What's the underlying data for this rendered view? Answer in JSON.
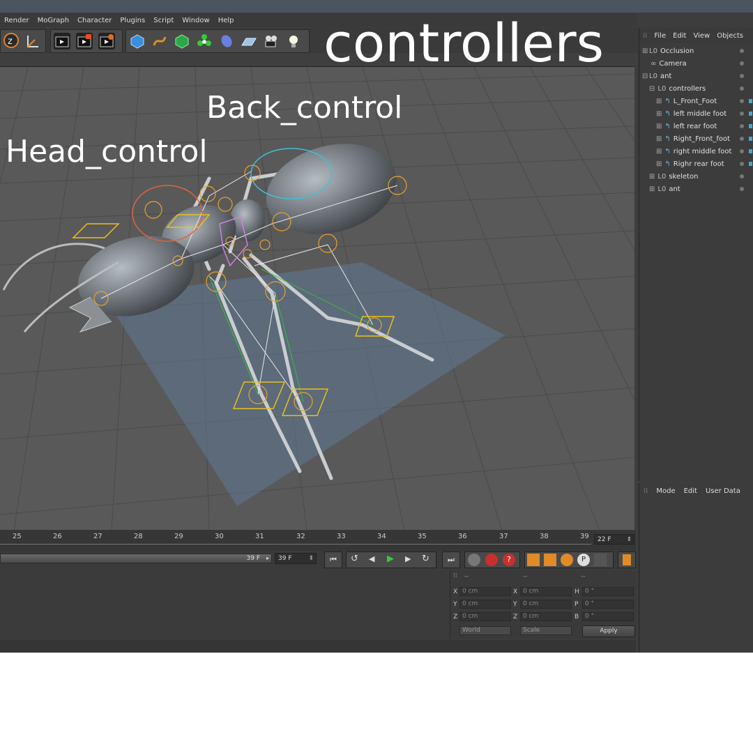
{
  "menu": [
    "Render",
    "MoGraph",
    "Character",
    "Plugins",
    "Script",
    "Window",
    "Help"
  ],
  "overlay": {
    "controllers": "controllers",
    "back_control": "Back_control",
    "head_control": "Head_control"
  },
  "object_panel": {
    "menu": [
      "File",
      "Edit",
      "View",
      "Objects"
    ],
    "items": [
      {
        "label": "Occlusion",
        "indent": 0
      },
      {
        "label": "Camera",
        "indent": 0
      },
      {
        "label": "ant",
        "indent": 0
      },
      {
        "label": "controllers",
        "indent": 1
      },
      {
        "label": "L_Front_Foot",
        "indent": 2
      },
      {
        "label": "left middle foot",
        "indent": 2
      },
      {
        "label": "left rear foot",
        "indent": 2
      },
      {
        "label": "Right_Front_foot",
        "indent": 2
      },
      {
        "label": "right middle foot",
        "indent": 2
      },
      {
        "label": "Righr rear foot",
        "indent": 2
      },
      {
        "label": "skeleton",
        "indent": 1
      },
      {
        "label": "ant",
        "indent": 1
      }
    ]
  },
  "attributes": {
    "menu": [
      "Mode",
      "Edit",
      "User Data"
    ]
  },
  "timeline": {
    "ticks": [
      "25",
      "26",
      "27",
      "28",
      "29",
      "30",
      "31",
      "32",
      "33",
      "34",
      "35",
      "36",
      "37",
      "38",
      "39"
    ],
    "current_frame": "22 F",
    "end_frame_a": "39 F",
    "end_frame_b": "39 F"
  },
  "coords": {
    "headers": [
      "--",
      "--",
      "--"
    ],
    "rows": [
      {
        "a": "X",
        "av": "0 cm",
        "b": "X",
        "bv": "0 cm",
        "c": "H",
        "cv": "0 °"
      },
      {
        "a": "Y",
        "av": "0 cm",
        "b": "Y",
        "bv": "0 cm",
        "c": "P",
        "cv": "0 °"
      },
      {
        "a": "Z",
        "av": "0 cm",
        "b": "Z",
        "bv": "0 cm",
        "c": "B",
        "cv": "0 °"
      }
    ],
    "world": "World",
    "scale": "Scale",
    "apply": "Apply"
  },
  "colors": {
    "accent_orange": "#e08a2a",
    "accent_blue": "#3fa0d0",
    "controller_yellow": "#e8c21a",
    "ik_green": "#35c235"
  }
}
